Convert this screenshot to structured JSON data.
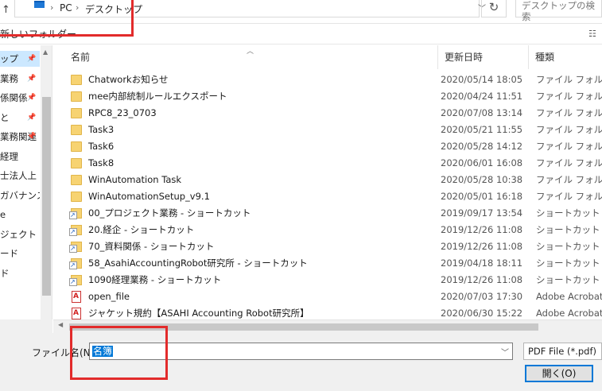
{
  "address": {
    "crumbs": [
      "PC",
      "デスクトップ"
    ],
    "search_placeholder": "デスクトップの検索",
    "refresh_symbol": "↻"
  },
  "toolbar": {
    "new_folder": "新しいフォルダー"
  },
  "nav": {
    "items": [
      {
        "label": "ップ",
        "pinned": true,
        "selected": true
      },
      {
        "label": "業務",
        "pinned": true
      },
      {
        "label": "係関係",
        "pinned": true
      },
      {
        "label": "と",
        "pinned": true
      },
      {
        "label": "業務関連",
        "pinned": true
      },
      {
        "label": "経理",
        "pinned": false
      },
      {
        "label": "士法人上",
        "pinned": false
      },
      {
        "label": "ガバナンス",
        "pinned": false
      },
      {
        "label": "e",
        "pinned": false
      },
      {
        "label": "ジェクト",
        "pinned": false
      },
      {
        "label": "ード",
        "pinned": false
      },
      {
        "label": "ド",
        "pinned": false
      }
    ]
  },
  "columns": {
    "name": "名前",
    "date": "更新日時",
    "type": "種類"
  },
  "files": [
    {
      "icon": "folder",
      "name": "Chatworkお知らせ",
      "date": "2020/05/14 18:05",
      "type": "ファイル フォルダー"
    },
    {
      "icon": "folder",
      "name": "mee内部統制ルールエクスポート",
      "date": "2020/04/24 11:51",
      "type": "ファイル フォルダー"
    },
    {
      "icon": "folder",
      "name": "RPC8_23_0703",
      "date": "2020/07/08 13:14",
      "type": "ファイル フォルダー"
    },
    {
      "icon": "folder",
      "name": "Task3",
      "date": "2020/05/21 11:55",
      "type": "ファイル フォルダー"
    },
    {
      "icon": "folder",
      "name": "Task6",
      "date": "2020/05/28 14:12",
      "type": "ファイル フォルダー"
    },
    {
      "icon": "folder",
      "name": "Task8",
      "date": "2020/06/01 16:08",
      "type": "ファイル フォルダー"
    },
    {
      "icon": "folder",
      "name": "WinAutomation Task",
      "date": "2020/05/28 10:38",
      "type": "ファイル フォルダー"
    },
    {
      "icon": "folder",
      "name": "WinAutomationSetup_v9.1",
      "date": "2020/05/01 16:18",
      "type": "ファイル フォルダー"
    },
    {
      "icon": "shortcut",
      "name": "00_プロジェクト業務 - ショートカット",
      "date": "2019/09/17 13:54",
      "type": "ショートカット"
    },
    {
      "icon": "shortcut",
      "name": "20.経企 - ショートカット",
      "date": "2019/12/26 11:08",
      "type": "ショートカット"
    },
    {
      "icon": "shortcut",
      "name": "70_資料関係 - ショートカット",
      "date": "2019/12/26 11:08",
      "type": "ショートカット"
    },
    {
      "icon": "shortcut",
      "name": "58_AsahiAccountingRobot研究所 - ショートカット",
      "date": "2019/04/18 18:11",
      "type": "ショートカット"
    },
    {
      "icon": "shortcut",
      "name": "1090経理業務 - ショートカット",
      "date": "2019/12/26 11:08",
      "type": "ショートカット"
    },
    {
      "icon": "pdf",
      "name": "open_file",
      "date": "2020/07/03 17:30",
      "type": "Adobe Acrobat"
    },
    {
      "icon": "pdf",
      "name": "ジャケット規約【ASAHI Accounting Robot研究所】",
      "date": "2020/06/30 15:22",
      "type": "Adobe Acrobat"
    }
  ],
  "footer": {
    "filename_label": "ファイル名(N):",
    "filename_value": "名簿",
    "file_type": "PDF File (*.pdf)",
    "open_button": "開く(O)"
  },
  "colors": {
    "highlight_box": "#e22b2b",
    "selection": "#0078d7",
    "nav_selected": "#cce8ff"
  }
}
